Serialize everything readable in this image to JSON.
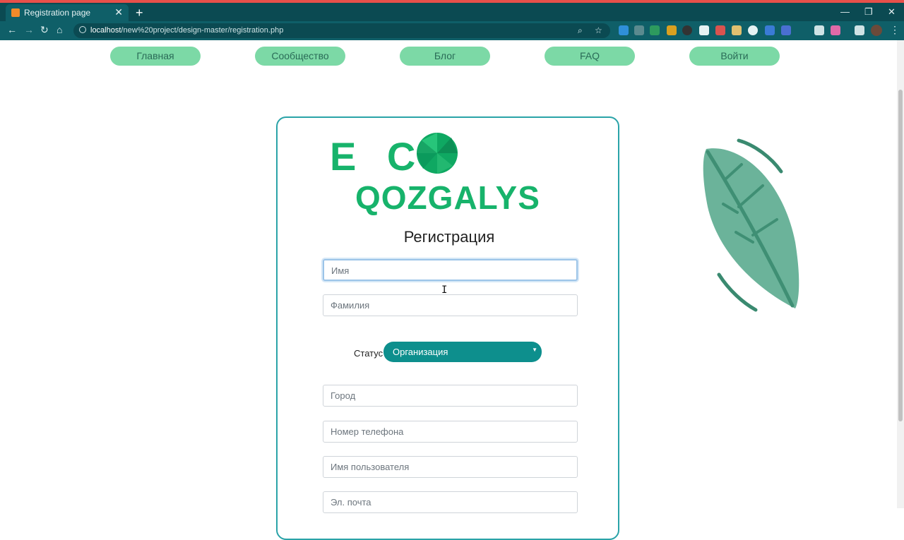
{
  "browser": {
    "tab_title": "Registration page",
    "tab_close": "✕",
    "new_tab": "+",
    "url_host": "localhost",
    "url_path": "/new%20project/design-master/registration.php",
    "window_min": "—",
    "window_max": "❐",
    "window_close": "✕"
  },
  "nav": {
    "items": [
      {
        "label": "Главная"
      },
      {
        "label": "Сообщество"
      },
      {
        "label": "Блог"
      },
      {
        "label": "FAQ"
      },
      {
        "label": "Войти"
      }
    ]
  },
  "logo": {
    "line1": "E C",
    "line2": "QOZGALYS"
  },
  "form": {
    "title": "Регистрация",
    "first_name_placeholder": "Имя",
    "last_name_placeholder": "Фамилия",
    "status_label": "Статус",
    "status_value": "Организация",
    "city_placeholder": "Город",
    "phone_placeholder": "Номер телефона",
    "username_placeholder": "Имя пользователя",
    "email_placeholder": "Эл. почта"
  },
  "colors": {
    "accent": "#0d8f8d",
    "brand": "#17b36b",
    "nav_pill": "#7cd9a6",
    "chrome": "#0f5f68"
  }
}
